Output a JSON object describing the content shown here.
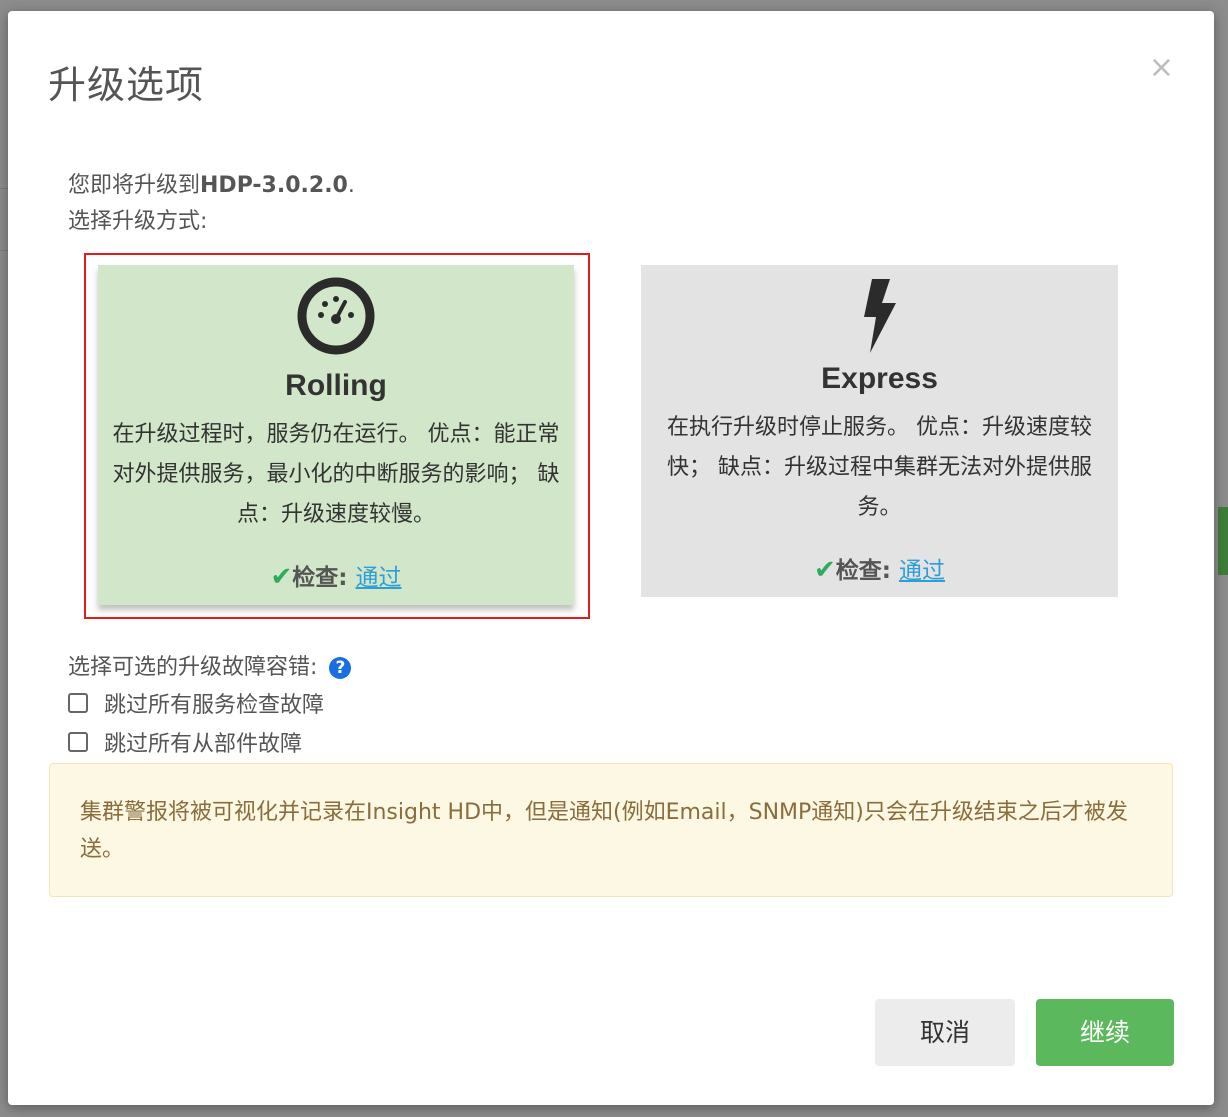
{
  "dialog": {
    "title": "升级选项",
    "close_label": "×"
  },
  "intro": {
    "target_prefix": "您即将升级到",
    "target_version": "HDP-3.0.2.0",
    "target_suffix": ".",
    "choose_label": "选择升级方式:"
  },
  "options": {
    "rolling": {
      "icon": "speedometer-icon",
      "name": "Rolling",
      "description": "在升级过程时，服务仍在运行。 优点：能正常对外提供服务，最小化的中断服务的影响； 缺点：升级速度较慢。",
      "check_label": "检查:",
      "check_result": "通过",
      "selected": true
    },
    "express": {
      "icon": "lightning-icon",
      "name": "Express",
      "description": "在执行升级时停止服务。 优点：升级速度较快； 缺点：升级过程中集群无法对外提供服务。",
      "check_label": "检查:",
      "check_result": "通过",
      "selected": false
    }
  },
  "tolerance": {
    "label": "选择可选的升级故障容错:",
    "help_icon": "?",
    "skip_service_check": {
      "label": "跳过所有服务检查故障",
      "checked": false
    },
    "skip_slave_failures": {
      "label": "跳过所有从部件故障",
      "checked": false
    }
  },
  "alert": {
    "text": "集群警报将被可视化并记录在Insight HD中，但是通知(例如Email，SNMP通知)只会在升级结束之后才被发送。"
  },
  "footer": {
    "cancel_label": "取消",
    "continue_label": "继续"
  },
  "colors": {
    "rolling_bg": "#d2e6c9",
    "express_bg": "#e3e3e3",
    "selected_outline": "#e31b1b",
    "check_ok": "#2eac5c",
    "link": "#2d9fd8",
    "alert_bg": "#fcf8e3",
    "alert_text": "#8a6d3b",
    "primary_button": "#5cb85c"
  }
}
